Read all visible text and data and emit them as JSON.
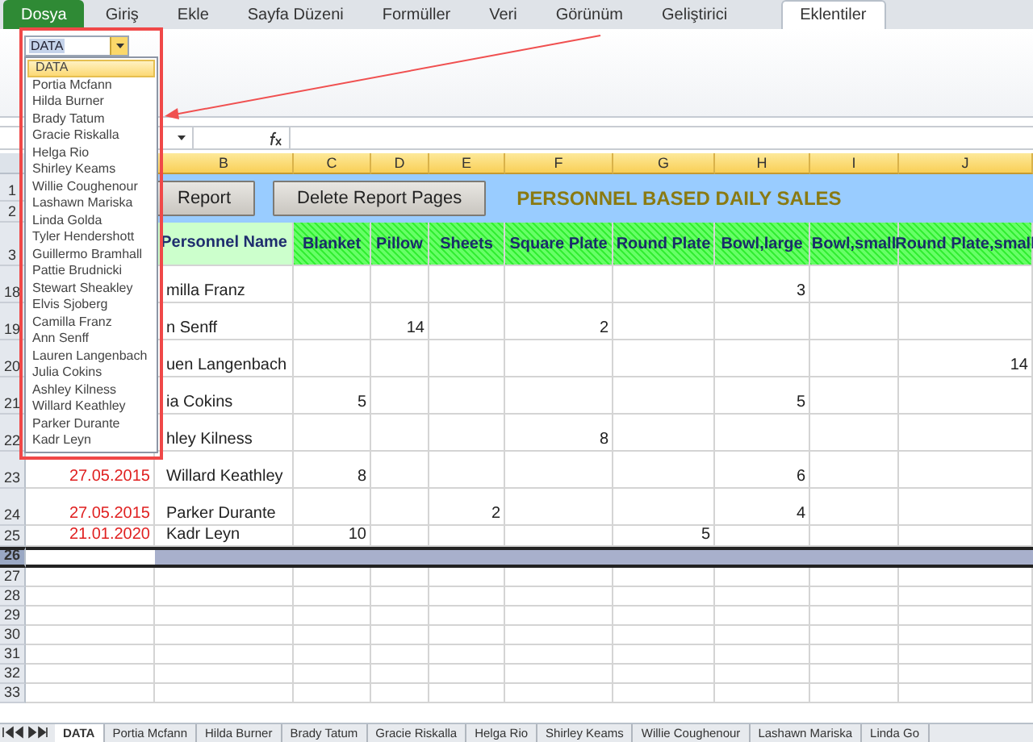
{
  "ribbon": {
    "tabs": [
      {
        "label": "Dosya",
        "kind": "file",
        "selected": false
      },
      {
        "label": "Giriş",
        "kind": "tab",
        "selected": false
      },
      {
        "label": "Ekle",
        "kind": "tab",
        "selected": false
      },
      {
        "label": "Sayfa Düzeni",
        "kind": "tab",
        "selected": false
      },
      {
        "label": "Formüller",
        "kind": "tab",
        "selected": false
      },
      {
        "label": "Veri",
        "kind": "tab",
        "selected": false
      },
      {
        "label": "Görünüm",
        "kind": "tab",
        "selected": false
      },
      {
        "label": "Geliştirici",
        "kind": "tab",
        "selected": false
      },
      {
        "label": "Eklentiler",
        "kind": "tab",
        "selected": true
      }
    ]
  },
  "combo": {
    "value": "DATA",
    "expanded": true,
    "items": [
      {
        "label": "DATA",
        "selected": true
      },
      {
        "label": "Portia Mcfann",
        "selected": false
      },
      {
        "label": "Hilda Burner",
        "selected": false
      },
      {
        "label": "Brady Tatum",
        "selected": false
      },
      {
        "label": "Gracie Riskalla",
        "selected": false
      },
      {
        "label": "Helga Rio",
        "selected": false
      },
      {
        "label": "Shirley Keams",
        "selected": false
      },
      {
        "label": "Willie Coughenour",
        "selected": false
      },
      {
        "label": "Lashawn Mariska",
        "selected": false
      },
      {
        "label": "Linda Golda",
        "selected": false
      },
      {
        "label": "Tyler Hendershott",
        "selected": false
      },
      {
        "label": "Guillermo Bramhall",
        "selected": false
      },
      {
        "label": "Pattie Brudnicki",
        "selected": false
      },
      {
        "label": "Stewart Sheakley",
        "selected": false
      },
      {
        "label": "Elvis Sjoberg",
        "selected": false
      },
      {
        "label": "Camilla Franz",
        "selected": false
      },
      {
        "label": "Ann Senff",
        "selected": false
      },
      {
        "label": "Lauren Langenbach",
        "selected": false
      },
      {
        "label": "Julia Cokins",
        "selected": false
      },
      {
        "label": "Ashley Kilness",
        "selected": false
      },
      {
        "label": "Willard Keathley",
        "selected": false
      },
      {
        "label": "Parker Durante",
        "selected": false
      },
      {
        "label": "Kadr Leyn",
        "selected": false
      }
    ]
  },
  "sheet": {
    "columns": [
      "B",
      "C",
      "D",
      "E",
      "F",
      "G",
      "H",
      "I",
      "J"
    ],
    "band_rows": [
      "1",
      "2"
    ],
    "buttons": [
      "Report",
      "Delete Report Pages"
    ],
    "title": "PERSONNEL BASED DAILY SALES",
    "header_row": {
      "row": "3",
      "name_header": "Personnel Name",
      "items": [
        "Blanket",
        "Pillow",
        "Sheets",
        "Square Plate",
        "Round Plate",
        "Bowl,large",
        "Bowl,small",
        "Round Plate,small"
      ]
    },
    "rows": [
      {
        "row": "18",
        "name": "milla Franz",
        "values": {
          "H": "3"
        }
      },
      {
        "row": "19",
        "name": "n Senff",
        "values": {
          "D": "14",
          "F": "2"
        }
      },
      {
        "row": "20",
        "name": "uen Langenbach",
        "values": {
          "J": "14"
        }
      },
      {
        "row": "21",
        "name": "ia Cokins",
        "values": {
          "C": "5",
          "H": "5"
        }
      },
      {
        "row": "22",
        "name": "hley Kilness",
        "values": {
          "F": "8"
        }
      },
      {
        "row": "23",
        "date": "27.05.2015",
        "name": "Willard Keathley",
        "values": {
          "C": "8",
          "H": "6"
        }
      },
      {
        "row": "24",
        "date": "27.05.2015",
        "name": "Parker Durante",
        "values": {
          "E": "2",
          "H": "4"
        }
      },
      {
        "row": "25",
        "date": "21.01.2020",
        "name": "Kadr Leyn",
        "values": {
          "C": "10",
          "G": "5"
        }
      }
    ],
    "empty_rows": [
      {
        "row": "26",
        "selected": true
      },
      {
        "row": "27",
        "selected": false
      },
      {
        "row": "28",
        "selected": false
      },
      {
        "row": "29",
        "selected": false
      },
      {
        "row": "30",
        "selected": false
      },
      {
        "row": "31",
        "selected": false
      },
      {
        "row": "32",
        "selected": false
      },
      {
        "row": "33",
        "selected": false
      }
    ]
  },
  "sheet_tabs": [
    {
      "label": "DATA",
      "selected": true
    },
    {
      "label": "Portia Mcfann",
      "selected": false
    },
    {
      "label": "Hilda Burner",
      "selected": false
    },
    {
      "label": "Brady Tatum",
      "selected": false
    },
    {
      "label": "Gracie Riskalla",
      "selected": false
    },
    {
      "label": "Helga Rio",
      "selected": false
    },
    {
      "label": "Shirley Keams",
      "selected": false
    },
    {
      "label": "Willie Coughenour",
      "selected": false
    },
    {
      "label": "Lashawn Mariska",
      "selected": false
    },
    {
      "label": "Linda Go",
      "selected": false
    }
  ]
}
